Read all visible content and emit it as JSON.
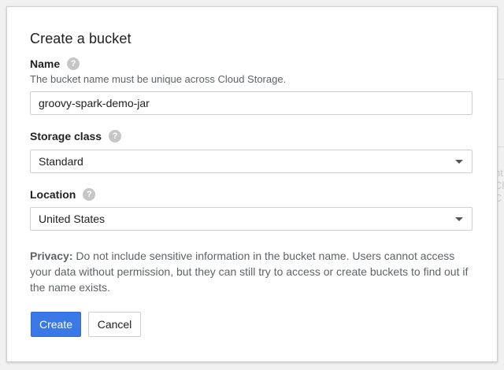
{
  "background": {
    "side_text": "nt\nClo\nC"
  },
  "dialog": {
    "title": "Create a bucket",
    "name_field": {
      "label": "Name",
      "help_icon": "help-circle-icon",
      "hint": "The bucket name must be unique across Cloud Storage.",
      "value": "groovy-spark-demo-jar"
    },
    "storage_class_field": {
      "label": "Storage class",
      "help_icon": "help-circle-icon",
      "selected": "Standard"
    },
    "location_field": {
      "label": "Location",
      "help_icon": "help-circle-icon",
      "selected": "United States"
    },
    "privacy": {
      "label": "Privacy:",
      "text": " Do not include sensitive information in the bucket name. Users cannot access your data without permission, but they can still try to access or create buckets to find out if the name exists."
    },
    "buttons": {
      "create_label": "Create",
      "cancel_label": "Cancel"
    }
  },
  "colors": {
    "primary_button": "#3b78e7",
    "help_icon": "#c6c6c6"
  }
}
